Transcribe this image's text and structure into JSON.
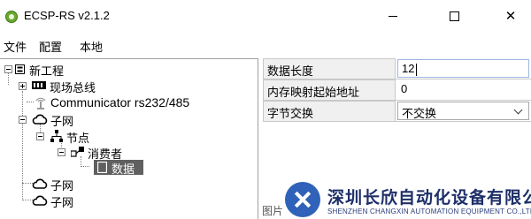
{
  "window": {
    "title": "ECSP-RS v2.1.2",
    "min_label": "—",
    "max_label": "☐",
    "close_label": "✕"
  },
  "menu": [
    {
      "label": "文件"
    },
    {
      "label": "配置"
    },
    {
      "label": "本地"
    }
  ],
  "tree": {
    "root": {
      "label": "新工程",
      "icon": "project-icon"
    },
    "fieldbus": {
      "label": "现场总线",
      "icon": "bus-icon"
    },
    "device": {
      "label": "Communicator rs232/485",
      "icon": "antenna-icon"
    },
    "subnet1": {
      "label": "子网",
      "icon": "cloud-icon"
    },
    "node": {
      "label": "节点",
      "icon": "network-icon"
    },
    "consumer": {
      "label": "消费者",
      "icon": "consumer-icon"
    },
    "data": {
      "label": "数据",
      "icon": "data-icon",
      "selected": true
    },
    "subnet2": {
      "label": "子网",
      "icon": "cloud-icon"
    },
    "subnet3": {
      "label": "子网",
      "icon": "cloud-icon"
    }
  },
  "properties": [
    {
      "name": "数据长度",
      "value": "12",
      "type": "input"
    },
    {
      "name": "内存映射起始地址",
      "value": "0",
      "type": "text"
    },
    {
      "name": "字节交换",
      "value": "不交换",
      "type": "select"
    }
  ],
  "watermark": {
    "company_cn": "深圳长欣自动化设备有限公司",
    "company_en": "SHENZHEN CHANGXIN AUTOMATION EQUIPMENT CO.,LTD",
    "pic_label": "图片"
  }
}
